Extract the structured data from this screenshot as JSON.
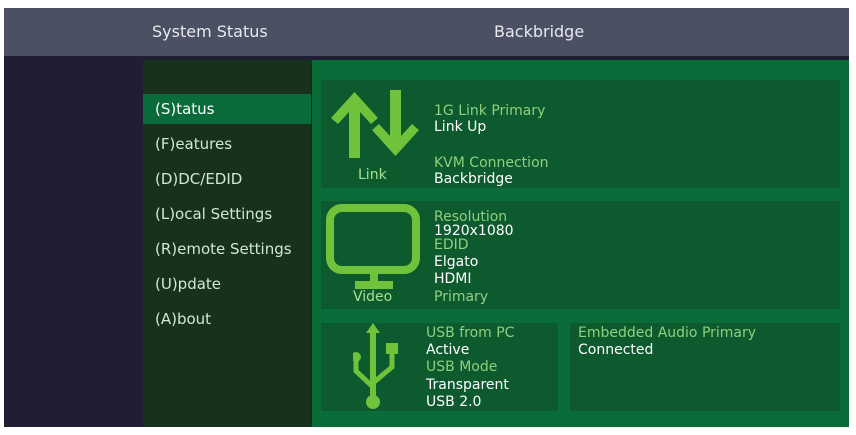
{
  "header": {
    "left_title": "System Status",
    "right_title": "Backbridge"
  },
  "menu": [
    {
      "label": "(S)tatus",
      "active": true
    },
    {
      "label": "(F)eatures"
    },
    {
      "label": "(D)DC/EDID"
    },
    {
      "label": "(L)ocal  Settings"
    },
    {
      "label": "(R)emote Settings"
    },
    {
      "label": "(U)pdate"
    },
    {
      "label": "(A)bout"
    }
  ],
  "link_panel": {
    "caption": "Link",
    "icon": "up-down-arrows-icon",
    "link_label": "1G Link Primary",
    "link_value": "Link Up",
    "kvm_label": "KVM Connection",
    "kvm_value": "Backbridge"
  },
  "video_panel": {
    "caption": "Video",
    "icon": "monitor-icon",
    "resolution_label": "Resolution",
    "resolution_value": "1920x1080",
    "edid_label": "EDID",
    "edid_value": "Elgato",
    "port_value": "HDMI",
    "port_role": "Primary"
  },
  "usb_panel": {
    "icon": "usb-icon",
    "usb_label": "USB from PC",
    "usb_value": "Active",
    "mode_label": "USB Mode",
    "mode_value": "Transparent",
    "version_value": "USB 2.0"
  },
  "audio_panel": {
    "label": "Embedded Audio Primary",
    "value": "Connected"
  },
  "colors": {
    "accent_green": "#6fc23a",
    "active_menu": "#0a6b3a",
    "panel": "#0d5a2f",
    "header": "#4b5062"
  }
}
